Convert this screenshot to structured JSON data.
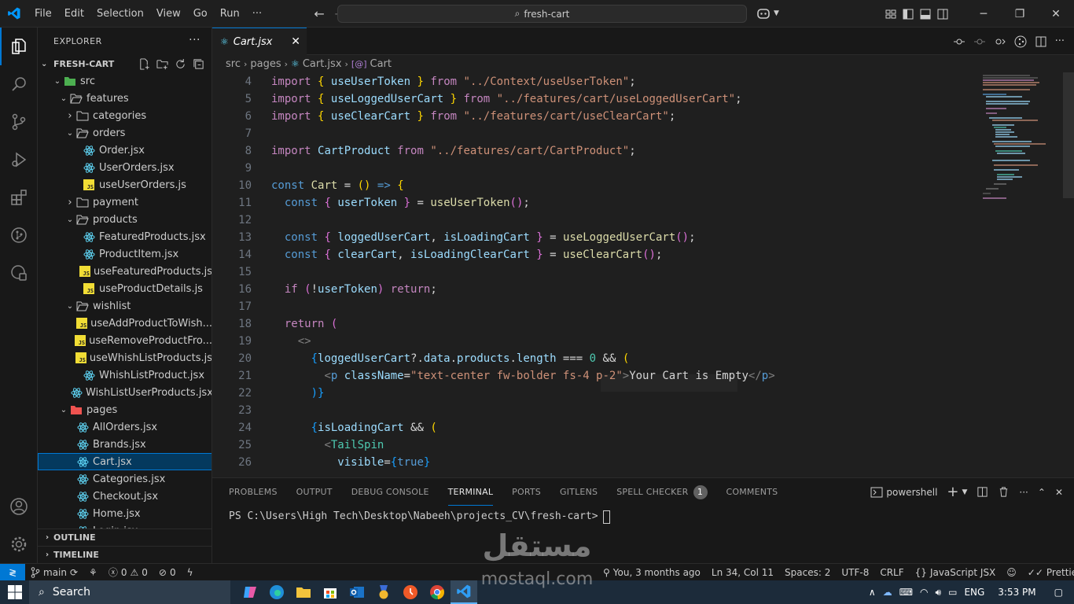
{
  "titlebar": {
    "menu": [
      "File",
      "Edit",
      "Selection",
      "View",
      "Go",
      "Run",
      "···"
    ],
    "search": "fresh-cart"
  },
  "explorer": {
    "title": "EXPLORER",
    "project": "FRESH-CART",
    "tree": [
      {
        "label": "src",
        "depth": 1,
        "type": "folder-src",
        "open": true
      },
      {
        "label": "features",
        "depth": 2,
        "type": "folder",
        "open": true
      },
      {
        "label": "categories",
        "depth": 3,
        "type": "folder",
        "open": false
      },
      {
        "label": "orders",
        "depth": 3,
        "type": "folder",
        "open": true
      },
      {
        "label": "Order.jsx",
        "depth": 4,
        "type": "react"
      },
      {
        "label": "UserOrders.jsx",
        "depth": 4,
        "type": "react"
      },
      {
        "label": "useUserOrders.js",
        "depth": 4,
        "type": "js"
      },
      {
        "label": "payment",
        "depth": 3,
        "type": "folder",
        "open": false
      },
      {
        "label": "products",
        "depth": 3,
        "type": "folder",
        "open": true
      },
      {
        "label": "FeaturedProducts.jsx",
        "depth": 4,
        "type": "react"
      },
      {
        "label": "ProductItem.jsx",
        "depth": 4,
        "type": "react"
      },
      {
        "label": "useFeaturedProducts.js",
        "depth": 4,
        "type": "js"
      },
      {
        "label": "useProductDetails.js",
        "depth": 4,
        "type": "js"
      },
      {
        "label": "wishlist",
        "depth": 3,
        "type": "folder",
        "open": true
      },
      {
        "label": "useAddProductToWish...",
        "depth": 4,
        "type": "js"
      },
      {
        "label": "useRemoveProductFro...",
        "depth": 4,
        "type": "js"
      },
      {
        "label": "useWhishListProducts.js",
        "depth": 4,
        "type": "js"
      },
      {
        "label": "WhishListProduct.jsx",
        "depth": 4,
        "type": "react"
      },
      {
        "label": "WishListUserProducts.jsx",
        "depth": 4,
        "type": "react"
      },
      {
        "label": "pages",
        "depth": 2,
        "type": "folder-pages",
        "open": true
      },
      {
        "label": "AllOrders.jsx",
        "depth": 3,
        "type": "react"
      },
      {
        "label": "Brands.jsx",
        "depth": 3,
        "type": "react"
      },
      {
        "label": "Cart.jsx",
        "depth": 3,
        "type": "react",
        "selected": true
      },
      {
        "label": "Categories.jsx",
        "depth": 3,
        "type": "react"
      },
      {
        "label": "Checkout.jsx",
        "depth": 3,
        "type": "react"
      },
      {
        "label": "Home.jsx",
        "depth": 3,
        "type": "react"
      },
      {
        "label": "Login.jsx",
        "depth": 3,
        "type": "react"
      }
    ],
    "outline": "OUTLINE",
    "timeline": "TIMELINE"
  },
  "editor": {
    "tab": "Cart.jsx",
    "breadcrumb": [
      "src",
      "pages",
      "Cart.jsx",
      "Cart"
    ],
    "lines": [
      {
        "n": "4",
        "html": "<span class='k'>import</span> <span class='p'>{</span> <span class='v'>useUserToken</span> <span class='p'>}</span> <span class='k'>from</span> <span class='s'>\"../Context/useUserToken\"</span>;"
      },
      {
        "n": "5",
        "html": "<span class='k'>import</span> <span class='p'>{</span> <span class='v'>useLoggedUserCart</span> <span class='p'>}</span> <span class='k'>from</span> <span class='s'>\"../features/cart/useLoggedUserCart\"</span>;"
      },
      {
        "n": "6",
        "html": "<span class='k'>import</span> <span class='p'>{</span> <span class='v'>useClearCart</span> <span class='p'>}</span> <span class='k'>from</span> <span class='s'>\"../features/cart/useClearCart\"</span>;"
      },
      {
        "n": "7",
        "html": ""
      },
      {
        "n": "8",
        "html": "<span class='k'>import</span> <span class='v'>CartProduct</span> <span class='k'>from</span> <span class='s'>\"../features/cart/CartProduct\"</span>;"
      },
      {
        "n": "9",
        "html": ""
      },
      {
        "n": "10",
        "html": "<span class='kb'>const</span> <span class='f'>Cart</span> = <span class='p'>()</span> <span class='kb'>=&gt;</span> <span class='p'>{</span>"
      },
      {
        "n": "11",
        "html": "  <span class='kb'>const</span> <span class='p2'>{</span> <span class='v'>userToken</span> <span class='p2'>}</span> = <span class='f'>useUserToken</span><span class='p2'>()</span>;"
      },
      {
        "n": "12",
        "html": ""
      },
      {
        "n": "13",
        "html": "  <span class='kb'>const</span> <span class='p2'>{</span> <span class='v'>loggedUserCart</span>, <span class='v'>isLoadingCart</span> <span class='p2'>}</span> = <span class='f'>useLoggedUserCart</span><span class='p2'>()</span>;"
      },
      {
        "n": "14",
        "html": "  <span class='kb'>const</span> <span class='p2'>{</span> <span class='v'>clearCart</span>, <span class='v'>isLoadingClearCart</span> <span class='p2'>}</span> = <span class='f'>useClearCart</span><span class='p2'>()</span>;"
      },
      {
        "n": "15",
        "html": ""
      },
      {
        "n": "16",
        "html": "  <span class='k'>if</span> <span class='p2'>(</span>!<span class='v'>userToken</span><span class='p2'>)</span> <span class='k'>return</span>;"
      },
      {
        "n": "17",
        "html": ""
      },
      {
        "n": "18",
        "html": "  <span class='k'>return</span> <span class='p2'>(</span>"
      },
      {
        "n": "19",
        "html": "    <span class='gray'>&lt;&gt;</span>"
      },
      {
        "n": "20",
        "html": "      <span class='p3'>{</span><span class='v'>loggedUserCart</span>?.<span class='v'>data</span>.<span class='v'>products</span>.<span class='v'>length</span> === <span class='c'>0</span> &amp;&amp; <span class='p'>(</span>"
      },
      {
        "n": "21",
        "html": "        <span class='gray'>&lt;</span><span class='t'>p</span> <span class='ta'>className</span>=<span class='s'>\"text-center fw-bolder fs-4 p-2\"</span><span class='gray'>&gt;</span>Your Cart is Empty<span class='gray'>&lt;/</span><span class='t'>p</span><span class='gray'>&gt;</span>"
      },
      {
        "n": "22",
        "html": "      <span class='p3'>)}</span>"
      },
      {
        "n": "23",
        "html": ""
      },
      {
        "n": "24",
        "html": "      <span class='p3'>{</span><span class='v'>isLoadingCart</span> &amp;&amp; <span class='p'>(</span>"
      },
      {
        "n": "25",
        "html": "        <span class='gray'>&lt;</span><span class='c'>TailSpin</span>"
      },
      {
        "n": "26",
        "html": "          <span class='ta'>visible</span>=<span class='p3'>{</span><span class='kb'>true</span><span class='p3'>}</span>"
      }
    ]
  },
  "panel": {
    "tabs": [
      "PROBLEMS",
      "OUTPUT",
      "DEBUG CONSOLE",
      "TERMINAL",
      "PORTS",
      "GITLENS",
      "SPELL CHECKER",
      "COMMENTS"
    ],
    "active_tab": "TERMINAL",
    "spell_badge": "1",
    "shell": "powershell",
    "prompt": "PS C:\\Users\\High Tech\\Desktop\\Nabeeh\\projects_CV\\fresh-cart>"
  },
  "statusbar": {
    "branch": "main",
    "errors": "0",
    "warnings": "0",
    "info": "0",
    "blame": "You, 3 months ago",
    "position": "Ln 34, Col 11",
    "spaces": "Spaces: 2",
    "encoding": "UTF-8",
    "eol": "CRLF",
    "language": "JavaScript JSX",
    "formatter": "Prettier"
  },
  "taskbar": {
    "search": "Search",
    "lang": "ENG",
    "time": "3:53 PM"
  },
  "watermark": {
    "arabic": "مستقل",
    "latin": "mostaql.com"
  },
  "colors": {
    "accent": "#0078d4",
    "selection": "#04395e"
  }
}
